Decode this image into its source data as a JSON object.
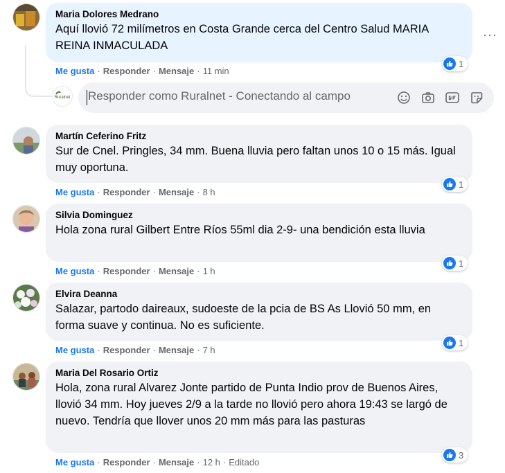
{
  "actions": {
    "like": "Me gusta",
    "reply": "Responder",
    "message": "Mensaje"
  },
  "reply_box": {
    "placeholder": "Responder como Ruralnet - Conectando al campo",
    "avatar_text": "Ruralnet"
  },
  "more_options": "···",
  "comments": [
    {
      "author": "Maria Dolores Medrano",
      "text": "Aquí llovió 72 milímetros en Costa Grande cerca del Centro Salud MARIA REINA INMACULADA",
      "time": "11 min",
      "edited": "",
      "reactions": "1"
    },
    {
      "author": "Martín Ceferino Fritz",
      "text": "Sur de Cnel. Pringles, 34 mm. Buena lluvia pero faltan unos 10 o 15 más. Igual muy oportuna.",
      "time": "8 h",
      "edited": "",
      "reactions": "1"
    },
    {
      "author": "Silvia Dominguez",
      "text": "Hola zona rural Gilbert Entre Ríos 55ml dia 2-9- una bendición esta lluvia",
      "time": "1 h",
      "edited": "",
      "reactions": "1"
    },
    {
      "author": "Elvira Deanna",
      "text": "Salazar, partodo daireaux, sudoeste de la pcia de BS As Llovió 50 mm, en forma suave y continua. No es suficiente.",
      "time": "7 h",
      "edited": "",
      "reactions": "1"
    },
    {
      "author": "Maria Del Rosario Ortiz",
      "text": "Hola, zona rural Alvarez Jonte partido de Punta Indio prov de Buenos Aires, llovió 34 mm. Hoy jueves 2/9 a la tarde no llovió pero ahora 19:43 se largó de nuevo. Tendría que llover unos 20 mm más para las pasturas",
      "time": "12 h",
      "edited": "Editado",
      "reactions": "3"
    }
  ],
  "colors": {
    "accent": "#1877f2",
    "bubble": "#f0f2f5",
    "bubble_highlight": "#e7f3ff",
    "muted": "#65676b"
  }
}
